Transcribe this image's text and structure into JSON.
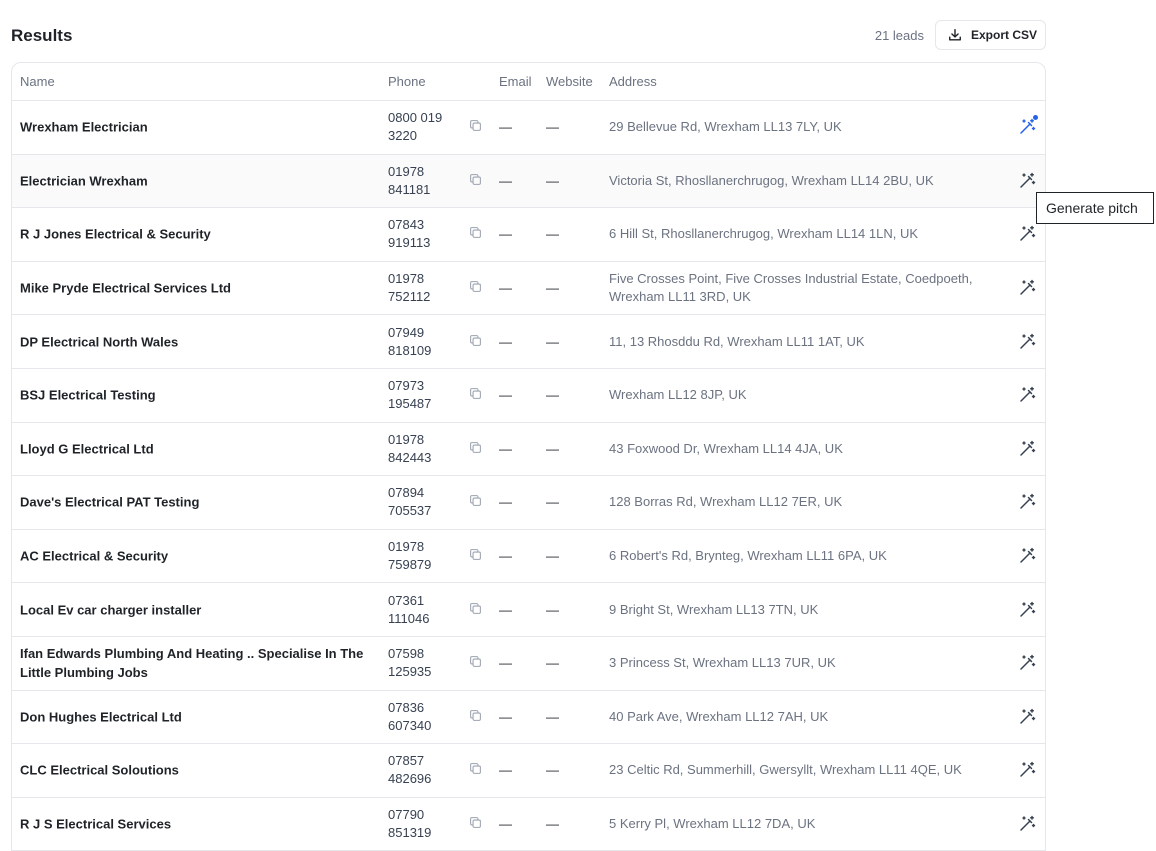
{
  "header": {
    "title": "Results",
    "lead_count": "21 leads",
    "export_label": "Export CSV"
  },
  "columns": {
    "name": "Name",
    "phone": "Phone",
    "email": "Email",
    "website": "Website",
    "address": "Address"
  },
  "rows": [
    {
      "name": "Wrexham Electrician",
      "phone": [
        "0800 019",
        "3220"
      ],
      "email": "—",
      "website": "—",
      "address": [
        "29 Bellevue Rd, Wrexham LL13 7LY, UK"
      ]
    },
    {
      "name": "Electrician Wrexham",
      "phone": [
        "01978",
        "841181"
      ],
      "email": "—",
      "website": "—",
      "address": [
        "Victoria St, Rhosllanerchrugog, Wrexham LL14 2BU, UK"
      ]
    },
    {
      "name": "R J Jones Electrical & Security",
      "phone": [
        "07843",
        "919113"
      ],
      "email": "—",
      "website": "—",
      "address": [
        "6 Hill St, Rhosllanerchrugog, Wrexham LL14 1LN, UK"
      ]
    },
    {
      "name": "Mike Pryde Electrical Services Ltd",
      "phone": [
        "01978",
        "752112"
      ],
      "email": "—",
      "website": "—",
      "address": [
        "Five Crosses Point, Five Crosses Industrial Estate, Coedpoeth,",
        "Wrexham LL11 3RD, UK"
      ]
    },
    {
      "name": "DP Electrical North Wales",
      "phone": [
        "07949",
        "818109"
      ],
      "email": "—",
      "website": "—",
      "address": [
        "11, 13 Rhosddu Rd, Wrexham LL11 1AT, UK"
      ]
    },
    {
      "name": "BSJ Electrical Testing",
      "phone": [
        "07973",
        "195487"
      ],
      "email": "—",
      "website": "—",
      "address": [
        "Wrexham LL12 8JP, UK"
      ]
    },
    {
      "name": "Lloyd G Electrical Ltd",
      "phone": [
        "01978",
        "842443"
      ],
      "email": "—",
      "website": "—",
      "address": [
        "43 Foxwood Dr, Wrexham LL14 4JA, UK"
      ]
    },
    {
      "name": "Dave's Electrical PAT Testing",
      "phone": [
        "07894",
        "705537"
      ],
      "email": "—",
      "website": "—",
      "address": [
        "128 Borras Rd, Wrexham LL12 7ER, UK"
      ]
    },
    {
      "name": "AC Electrical & Security",
      "phone": [
        "01978",
        "759879"
      ],
      "email": "—",
      "website": "—",
      "address": [
        "6 Robert's Rd, Brynteg, Wrexham LL11 6PA, UK"
      ]
    },
    {
      "name": "Local Ev car charger installer",
      "phone": [
        "07361",
        "111046"
      ],
      "email": "—",
      "website": "—",
      "address": [
        "9 Bright St, Wrexham LL13 7TN, UK"
      ]
    },
    {
      "name": "Ifan Edwards Plumbing And Heating .. Specialise In The Little Plumbing Jobs",
      "phone": [
        "07598",
        "125935"
      ],
      "email": "—",
      "website": "—",
      "address": [
        "3 Princess St, Wrexham LL13 7UR, UK"
      ]
    },
    {
      "name": "Don Hughes Electrical Ltd",
      "phone": [
        "07836",
        "607340"
      ],
      "email": "—",
      "website": "—",
      "address": [
        "40 Park Ave, Wrexham LL12 7AH, UK"
      ]
    },
    {
      "name": "CLC Electrical Soloutions",
      "phone": [
        "07857",
        "482696"
      ],
      "email": "—",
      "website": "—",
      "address": [
        "23 Celtic Rd, Summerhill, Gwersyllt, Wrexham LL11 4QE, UK"
      ]
    },
    {
      "name": "R J S Electrical Services",
      "phone": [
        "07790",
        "851319"
      ],
      "email": "—",
      "website": "—",
      "address": [
        "5 Kerry Pl, Wrexham LL12 7DA, UK"
      ]
    }
  ],
  "tooltip": "Generate pitch",
  "colors": {
    "accent": "#2563eb",
    "border": "#e5e7eb",
    "muted_text": "#6b7280"
  },
  "icons": {
    "export": "download-icon",
    "copy": "copy-icon",
    "pitch": "magic-wand-icon"
  }
}
